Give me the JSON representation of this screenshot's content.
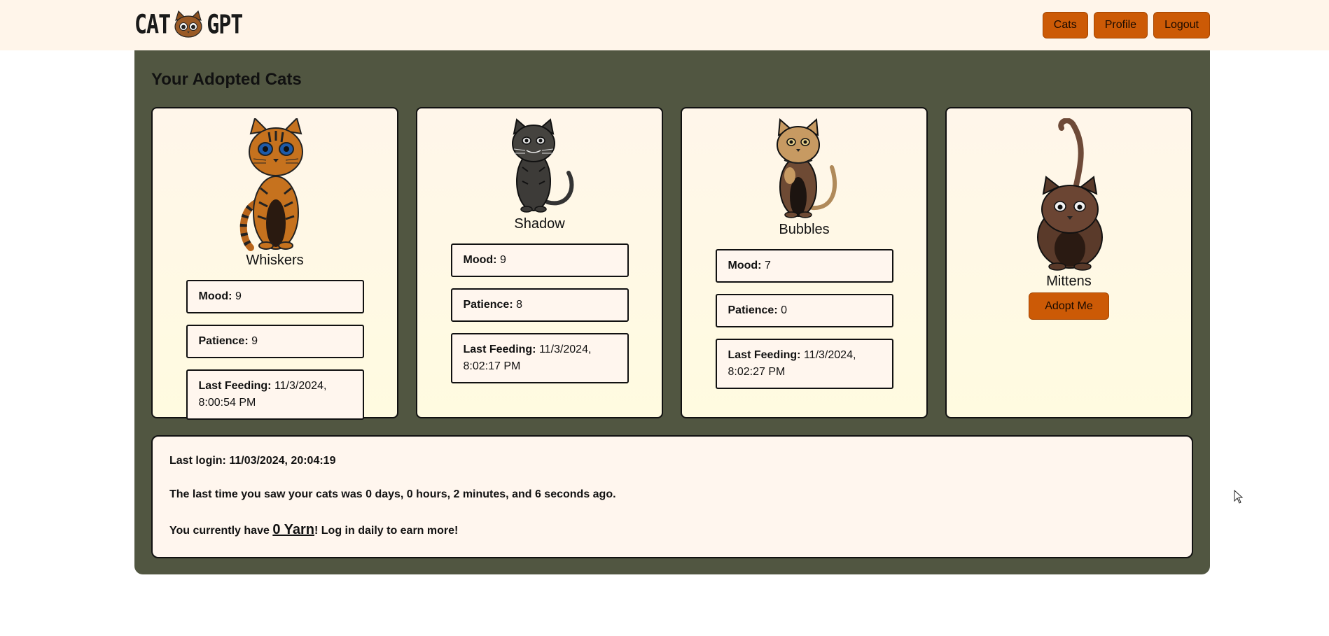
{
  "header": {
    "logo_left": "CAT",
    "logo_right": "GPT",
    "nav": [
      {
        "label": "Cats"
      },
      {
        "label": "Profile"
      },
      {
        "label": "Logout"
      }
    ]
  },
  "main": {
    "title": "Your Adopted Cats",
    "cats": [
      {
        "name": "Whiskers",
        "mood_label": "Mood:",
        "mood": "9",
        "patience_label": "Patience:",
        "patience": "9",
        "feeding_label": "Last Feeding:",
        "feeding": "11/3/2024, 8:00:54 PM"
      },
      {
        "name": "Shadow",
        "mood_label": "Mood:",
        "mood": "9",
        "patience_label": "Patience:",
        "patience": "8",
        "feeding_label": "Last Feeding:",
        "feeding": "11/3/2024, 8:02:17 PM"
      },
      {
        "name": "Bubbles",
        "mood_label": "Mood:",
        "mood": "7",
        "patience_label": "Patience:",
        "patience": "0",
        "feeding_label": "Last Feeding:",
        "feeding": "11/3/2024, 8:02:27 PM"
      },
      {
        "name": "Mittens",
        "adopt_label": "Adopt Me"
      }
    ],
    "info": {
      "last_login": "Last login: 11/03/2024, 20:04:19",
      "last_seen": "The last time you saw your cats was 0 days, 0 hours, 2 minutes, and 6 seconds ago.",
      "yarn_prefix": "You currently have ",
      "yarn_amount": "0 Yarn",
      "yarn_suffix": "! Log in daily to earn more!"
    }
  },
  "colors": {
    "topbar": "#fff5ea",
    "panel": "#515641",
    "accent_button": "#cc5a06",
    "card_bg": "#fff6ea"
  },
  "icons": [
    "cat-face-logo-icon",
    "cursor-arrow-icon"
  ]
}
